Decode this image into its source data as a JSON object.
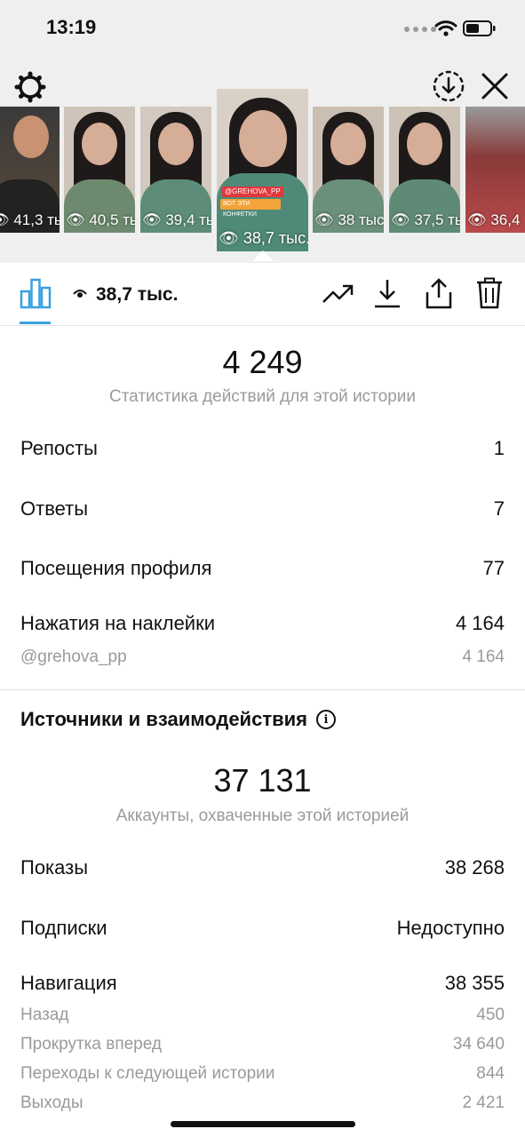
{
  "status_bar": {
    "time": "13:19"
  },
  "stories": [
    {
      "views": "41,3 тыс."
    },
    {
      "views": "40,5 тыс."
    },
    {
      "views": "39,4 тыс."
    },
    {
      "views": "38,7 тыс.",
      "selected": true,
      "tag": "@GREHOVA_PP",
      "caption": "ВОТ ЭТИ КОНФЕТКИ"
    },
    {
      "views": "38 тыс."
    },
    {
      "views": "37,5 тыс."
    },
    {
      "views": "36,4"
    }
  ],
  "toolbar": {
    "views": "38,7 тыс."
  },
  "actions": {
    "total": "4 249",
    "caption": "Статистика действий для этой истории",
    "rows": [
      {
        "label": "Репосты",
        "value": "1"
      },
      {
        "label": "Ответы",
        "value": "7"
      },
      {
        "label": "Посещения профиля",
        "value": "77"
      },
      {
        "label": "Нажатия на наклейки",
        "value": "4 164"
      }
    ],
    "sticker_sub": {
      "label": "@grehova_pp",
      "value": "4 164"
    }
  },
  "discovery": {
    "title": "Источники и взаимодействия",
    "total": "37 131",
    "caption": "Аккаунты, охваченные этой историей",
    "rows": [
      {
        "label": "Показы",
        "value": "38 268"
      },
      {
        "label": "Подписки",
        "value": "Недоступно"
      },
      {
        "label": "Навигация",
        "value": "38 355"
      }
    ],
    "navigation_sub": [
      {
        "label": "Назад",
        "value": "450"
      },
      {
        "label": "Прокрутка вперед",
        "value": "34 640"
      },
      {
        "label": "Переходы к следующей истории",
        "value": "844"
      },
      {
        "label": "Выходы",
        "value": "2 421"
      }
    ]
  },
  "colors": {
    "accent": "#3aa0e0",
    "muted": "#9a9a9a",
    "header_bg": "#efefef"
  }
}
